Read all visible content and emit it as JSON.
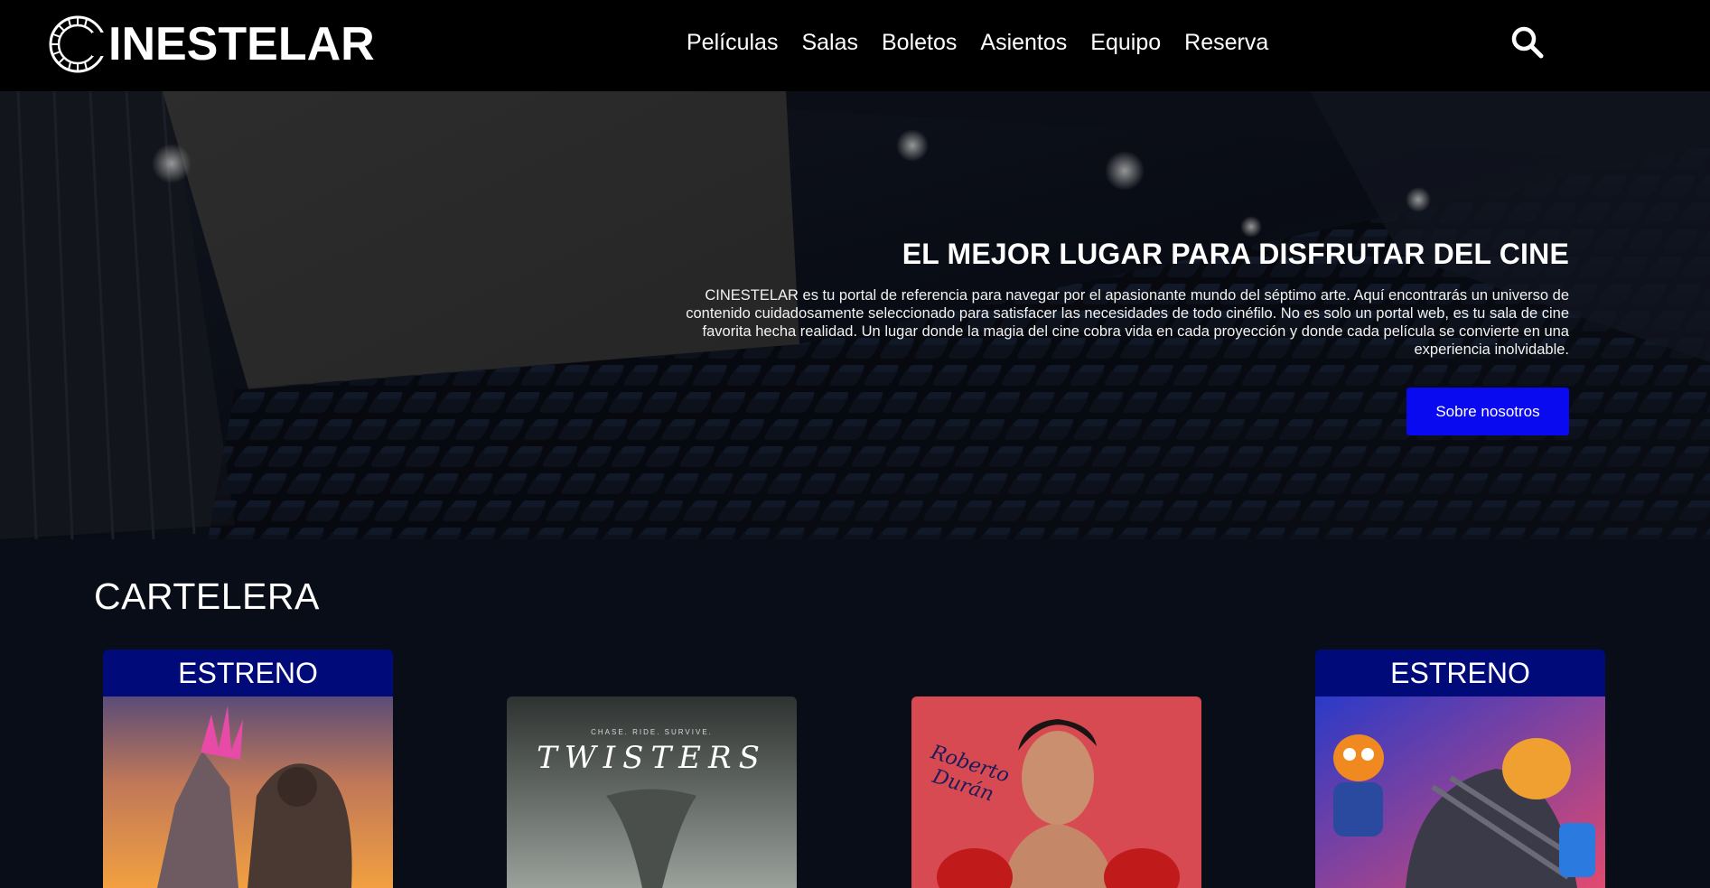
{
  "header": {
    "logo_text": "INESTELAR",
    "nav": [
      "Películas",
      "Salas",
      "Boletos",
      "Asientos",
      "Equipo",
      "Reserva"
    ]
  },
  "hero": {
    "title": "EL MEJOR LUGAR PARA DISFRUTAR DEL CINE",
    "text": "CINESTELAR es tu portal de referencia para navegar por el apasionante mundo del séptimo arte. Aquí encontrarás un universo de contenido cuidadosamente seleccionado para satisfacer las necesidades de todo cinéfilo. No es solo un portal web, es tu sala de cine favorita hecha realidad. Un lugar donde la magia del cine cobra vida en cada proyección y donde cada película se convierte en una experiencia inolvidable.",
    "button_label": "Sobre nosotros"
  },
  "cartelera": {
    "title": "CARTELERA",
    "cards": [
      {
        "badge": "ESTRENO"
      },
      {
        "tagline": "CHASE. RIDE. SURVIVE.",
        "poster_title": "TWISTERS"
      },
      {
        "signature": "Roberto Durán"
      },
      {
        "badge": "ESTRENO"
      }
    ]
  },
  "colors": {
    "header_bg": "#000000",
    "page_bg": "#080d17",
    "button_bg": "#0a0af0",
    "badge_bg": "#000a78"
  },
  "icons": [
    "film-reel-logo-icon",
    "search-icon"
  ]
}
